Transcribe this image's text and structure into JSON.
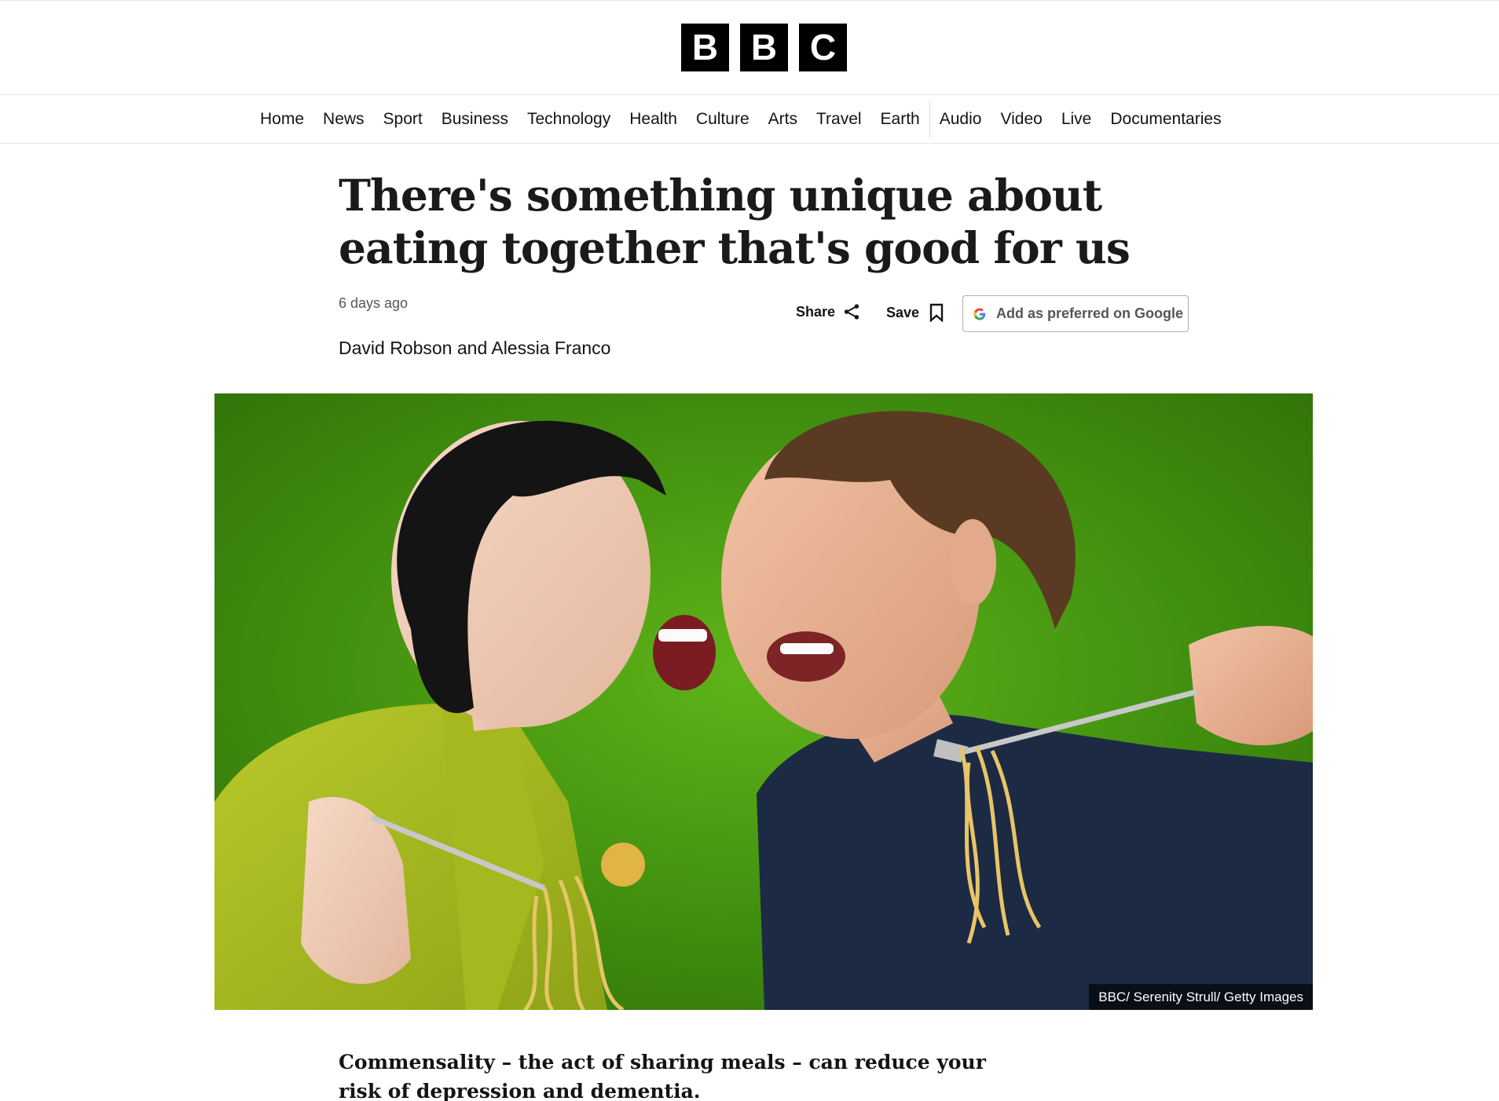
{
  "brand": {
    "letters": [
      "B",
      "B",
      "C"
    ]
  },
  "nav": {
    "items": [
      "Home",
      "News",
      "Sport",
      "Business",
      "Technology",
      "Health",
      "Culture",
      "Arts",
      "Travel",
      "Earth",
      "Audio",
      "Video",
      "Live",
      "Documentaries"
    ]
  },
  "article": {
    "headline": "There's something unique about eating together that's good for us",
    "date": "6 days ago",
    "byline": "David Robson and Alessia Franco",
    "actions": {
      "share_label": "Share",
      "save_label": "Save",
      "google_label": "Add as preferred on Google"
    },
    "image": {
      "credit": "BBC/ Serenity Strull/ Getty Images",
      "background_color": "#3f8a0f"
    },
    "summary": "Commensality – the act of sharing meals – can reduce your risk of depression and dementia."
  },
  "icons": {
    "share": "share-icon",
    "save": "bookmark-icon",
    "google": "google-icon"
  }
}
